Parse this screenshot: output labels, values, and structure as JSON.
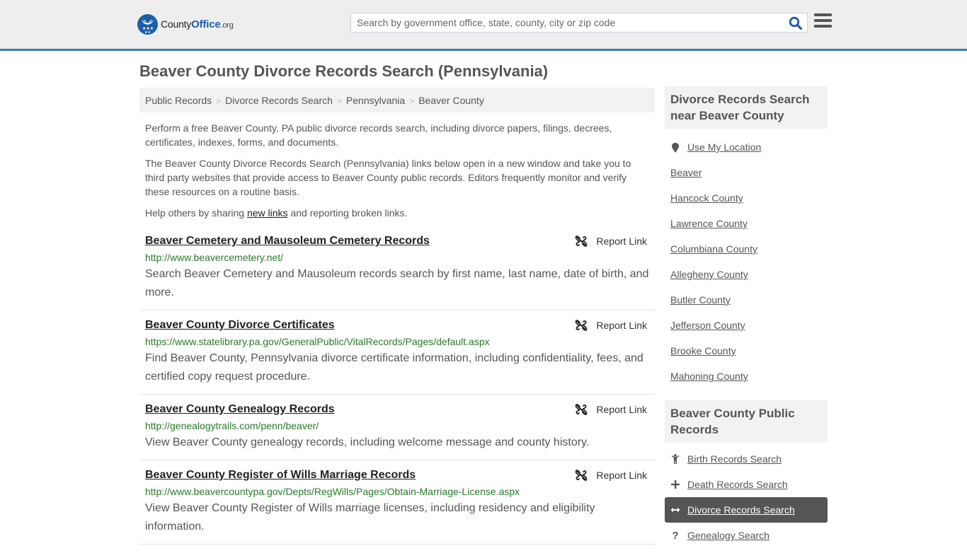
{
  "header": {
    "logo_main": "County",
    "logo_accent": "Office",
    "logo_suffix": ".org",
    "search_placeholder": "Search by government office, state, county, city or zip code",
    "brand_color": "#1e5ea8",
    "accent_bar_color": "#3a7bb0"
  },
  "page": {
    "title": "Beaver County Divorce Records Search (Pennsylvania)"
  },
  "breadcrumb": [
    "Public Records",
    "Divorce Records Search",
    "Pennsylvania",
    "Beaver County"
  ],
  "intro": {
    "p1": "Perform a free Beaver County, PA public divorce records search, including divorce papers, filings, decrees, certificates, indexes, forms, and documents.",
    "p2": "The Beaver County Divorce Records Search (Pennsylvania) links below open in a new window and take you to third party websites that provide access to Beaver County public records. Editors frequently monitor and verify these resources on a routine basis.",
    "p3_before": "Help others by sharing ",
    "p3_link": "new links",
    "p3_after": " and reporting broken links."
  },
  "results": [
    {
      "title": "Beaver Cemetery and Mausoleum Cemetery Records",
      "url": "http://www.beavercemetery.net/",
      "description": "Search Beaver Cemetery and Mausoleum records search by first name, last name, date of birth, and more.",
      "report_label": "Report Link"
    },
    {
      "title": "Beaver County Divorce Certificates",
      "url": "https://www.statelibrary.pa.gov/GeneralPublic/VitalRecords/Pages/default.aspx",
      "description": "Find Beaver County, Pennsylvania divorce certificate information, including confidentiality, fees, and certified copy request procedure.",
      "report_label": "Report Link"
    },
    {
      "title": "Beaver County Genealogy Records",
      "url": "http://genealogytrails.com/penn/beaver/",
      "description": "View Beaver County genealogy records, including welcome message and county history.",
      "report_label": "Report Link"
    },
    {
      "title": "Beaver County Register of Wills Marriage Records",
      "url": "http://www.beavercountypa.gov/Depts/RegWills/Pages/Obtain-Marriage-License.aspx",
      "description": "View Beaver County Register of Wills marriage licenses, including residency and eligibility information.",
      "report_label": "Report Link"
    }
  ],
  "sidebar": {
    "nearby": {
      "heading": "Divorce Records Search near Beaver County",
      "use_location": "Use My Location",
      "items": [
        "Beaver",
        "Hancock County",
        "Lawrence County",
        "Columbiana County",
        "Allegheny County",
        "Butler County",
        "Jefferson County",
        "Brooke County",
        "Mahoning County"
      ]
    },
    "public_records": {
      "heading": "Beaver County Public Records",
      "items": [
        {
          "label": "Birth Records Search",
          "icon": "child-icon",
          "active": false
        },
        {
          "label": "Death Records Search",
          "icon": "plus-icon",
          "active": false
        },
        {
          "label": "Divorce Records Search",
          "icon": "arrows-horizontal-icon",
          "active": true
        },
        {
          "label": "Genealogy Search",
          "icon": "question-icon",
          "active": false
        }
      ]
    }
  }
}
